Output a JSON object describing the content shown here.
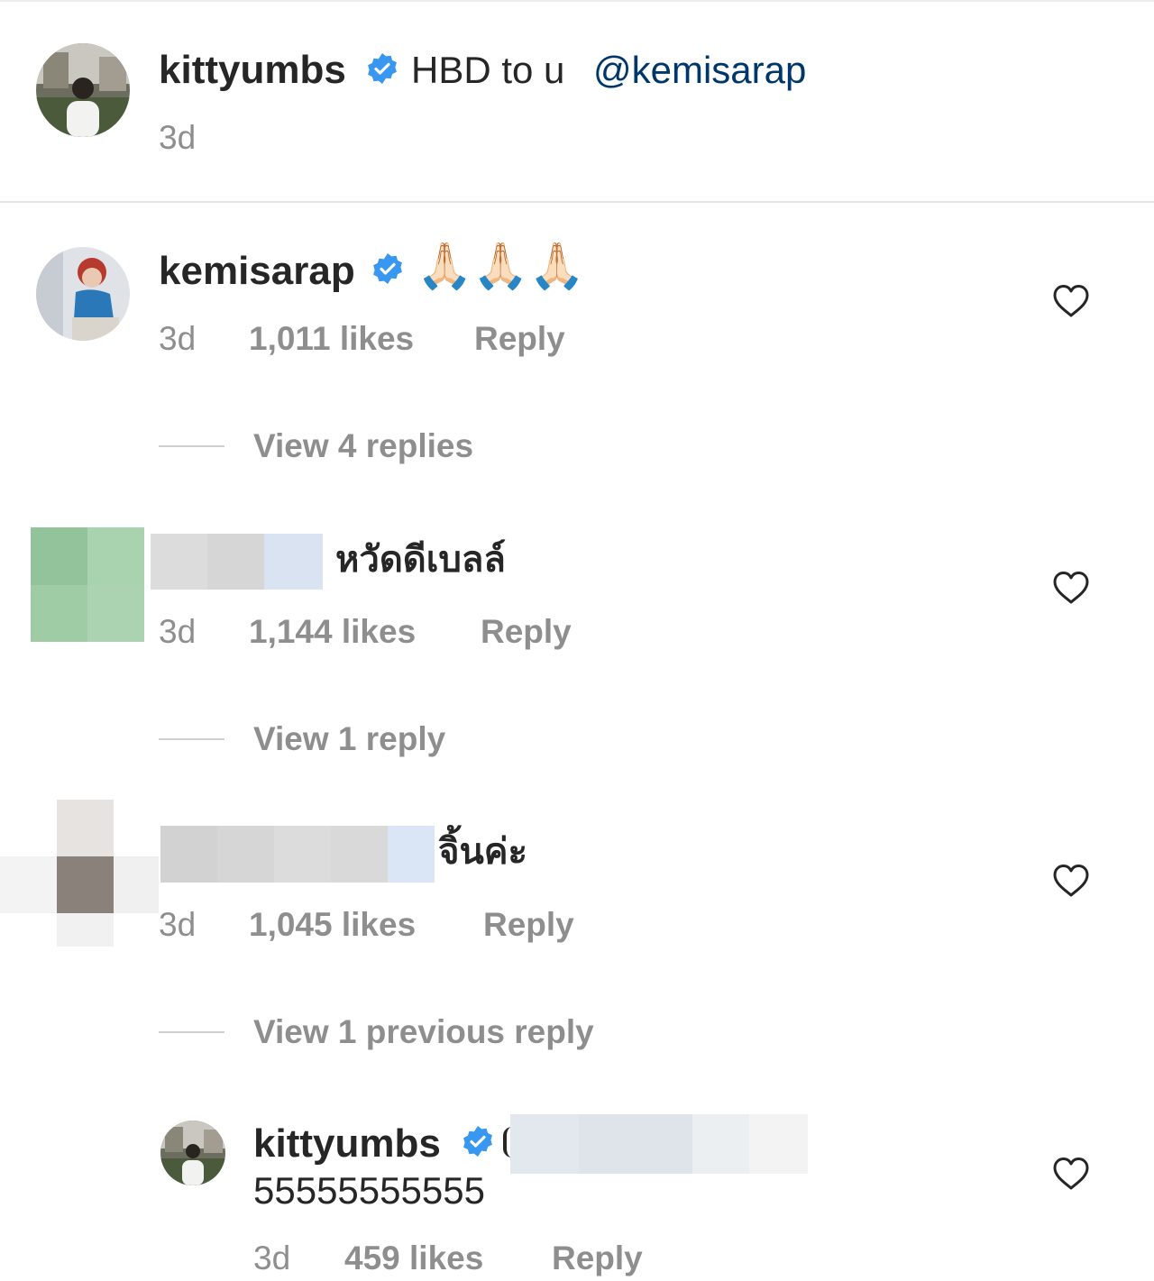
{
  "post": {
    "username": "kittyumbs",
    "caption": "HBD to u",
    "mention": "@kemisarap",
    "time": "3d"
  },
  "comments": [
    {
      "username": "kemisarap",
      "text": "🙏🏻🙏🏻🙏🏻",
      "time": "3d",
      "likes": "1,011 likes",
      "reply_label": "Reply",
      "view_replies": "View 4 replies"
    },
    {
      "username": "",
      "text": "หวัดดีเบลล์",
      "time": "3d",
      "likes": "1,144 likes",
      "reply_label": "Reply",
      "view_replies": "View 1 reply"
    },
    {
      "username": "",
      "text": "จิ้นค่ะ",
      "time": "3d",
      "likes": "1,045 likes",
      "reply_label": "Reply",
      "view_replies": "View 1 previous reply"
    }
  ],
  "reply": {
    "username": "kittyumbs",
    "text": "55555555555",
    "time": "3d",
    "likes": "459 likes",
    "reply_label": "Reply"
  },
  "colors": {
    "verified": "#3897f0",
    "mention": "#00376b",
    "meta": "#8e8e8e"
  },
  "icons": {
    "verified": "verified-badge-icon",
    "like": "heart-icon"
  }
}
